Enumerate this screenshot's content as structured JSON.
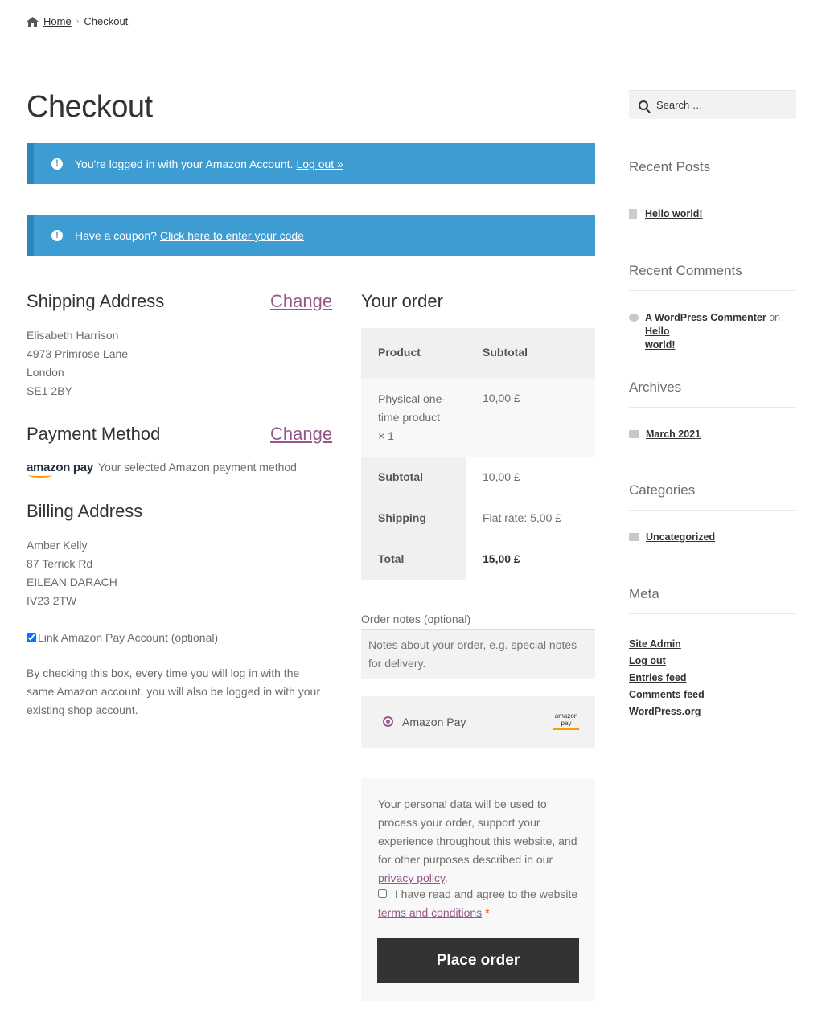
{
  "breadcrumb": {
    "home": "Home",
    "current": "Checkout"
  },
  "page_title": "Checkout",
  "notices": {
    "amazon_login_text": "You're logged in with your Amazon Account.",
    "amazon_logout_link": "Log out »",
    "coupon_text": "Have a coupon?",
    "coupon_link": "Click here to enter your code"
  },
  "shipping": {
    "title": "Shipping Address",
    "change": "Change",
    "lines": [
      "Elisabeth Harrison",
      "4973 Primrose Lane",
      "London",
      "SE1 2BY"
    ]
  },
  "payment": {
    "title": "Payment Method",
    "change": "Change",
    "logo_text": "amazon pay",
    "description": "Your selected Amazon payment method"
  },
  "billing": {
    "title": "Billing Address",
    "lines": [
      "Amber Kelly",
      "87 Terrick Rd",
      "EILEAN DARACH",
      "IV23 2TW"
    ]
  },
  "link_account": {
    "label": "Link Amazon Pay Account (optional)",
    "checked": true,
    "description": "By checking this box, every time you will log in with the same Amazon account, you will also be logged in with your existing shop account."
  },
  "order": {
    "title": "Your order",
    "header_product": "Product",
    "header_subtotal": "Subtotal",
    "item_name_1": "Physical one-",
    "item_name_2": "time product",
    "item_qty": "× 1",
    "item_price": "10,00 £",
    "subtotal_label": "Subtotal",
    "subtotal_value": "10,00 £",
    "shipping_label": "Shipping",
    "shipping_value": "Flat rate: 5,00 £",
    "total_label": "Total",
    "total_value": "15,00 £"
  },
  "notes": {
    "label": "Order notes (optional)",
    "placeholder": "Notes about your order, e.g. special notes for delivery."
  },
  "payment_option": {
    "label": "Amazon Pay",
    "badge_top": "amazon",
    "badge_bottom": "pay"
  },
  "terms": {
    "privacy_text": "Your personal data will be used to process your order, support your experience throughout this website, and for other purposes described in our",
    "privacy_link": "privacy policy",
    "privacy_end": ".",
    "agree_text": "I have read and agree to the website",
    "terms_link": "terms and conditions",
    "required": "*"
  },
  "place_order": "Place order",
  "sidebar": {
    "search_placeholder": "Search …",
    "recent_posts_title": "Recent Posts",
    "recent_posts": [
      "Hello world!"
    ],
    "recent_comments_title": "Recent Comments",
    "comment_author": "A WordPress Commenter",
    "comment_on": "on",
    "comment_post_1": "Hello",
    "comment_post_2": "world!",
    "archives_title": "Archives",
    "archives": [
      "March 2021"
    ],
    "categories_title": "Categories",
    "categories": [
      "Uncategorized"
    ],
    "meta_title": "Meta",
    "meta_links": [
      "Site Admin",
      "Log out",
      "Entries feed",
      "Comments feed",
      "WordPress.org"
    ]
  },
  "colors": {
    "notice": "#3d9cd2",
    "accent": "#96588a",
    "button": "#333333"
  }
}
